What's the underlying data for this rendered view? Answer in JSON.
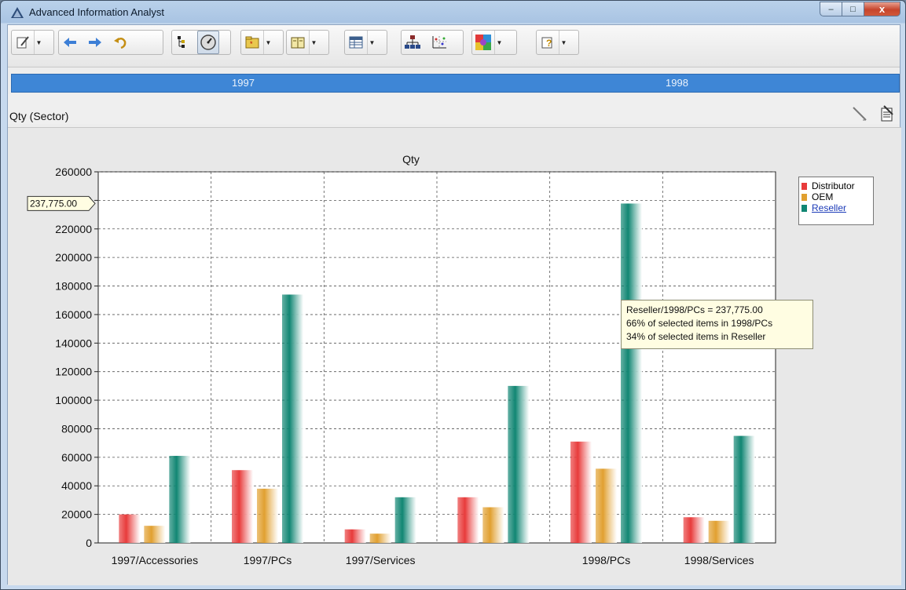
{
  "window": {
    "title": "Advanced Information Analyst"
  },
  "window_buttons": {
    "minimize": "–",
    "maximize": "□",
    "close": "x"
  },
  "toolbar": {
    "icons": [
      "edit-icon",
      "back-arrow-icon",
      "forward-arrow-icon",
      "undo-icon",
      "outline-icon",
      "chart-dial-icon",
      "folder-icon",
      "book-icon",
      "table-icon",
      "hierarchy-icon",
      "scatter-icon",
      "color-palette-icon",
      "help-icon"
    ]
  },
  "year_bar": {
    "years": [
      "1997",
      "1998"
    ]
  },
  "sector": {
    "label": "Qty (Sector)"
  },
  "chart_data": {
    "type": "bar",
    "title": "Qty",
    "categories": [
      "1997/Accessories",
      "1997/PCs",
      "1997/Services",
      "",
      "1998/PCs",
      "1998/Services"
    ],
    "series": [
      {
        "name": "Distributor",
        "values": [
          20000,
          51000,
          9500,
          32000,
          71000,
          18000
        ],
        "color": "#e83b3b"
      },
      {
        "name": "OEM",
        "values": [
          12000,
          38000,
          6500,
          25000,
          52000,
          15500
        ],
        "color": "#e1a030"
      },
      {
        "name": "Reseller",
        "values": [
          61000,
          174000,
          32000,
          110000,
          237775,
          75000
        ],
        "color": "#118673"
      }
    ],
    "ylim": [
      0,
      260000
    ],
    "yticks": [
      0,
      20000,
      40000,
      60000,
      80000,
      100000,
      120000,
      140000,
      160000,
      180000,
      200000,
      220000,
      240000,
      260000
    ],
    "grid": true,
    "legend": "top-right",
    "marker_label": "237,775.00",
    "marker_value": 237775
  },
  "tooltip": {
    "line1": "Reseller/1998/PCs = 237,775.00",
    "line2": "66% of selected items in 1998/PCs",
    "line3": "34% of selected items in Reseller"
  }
}
